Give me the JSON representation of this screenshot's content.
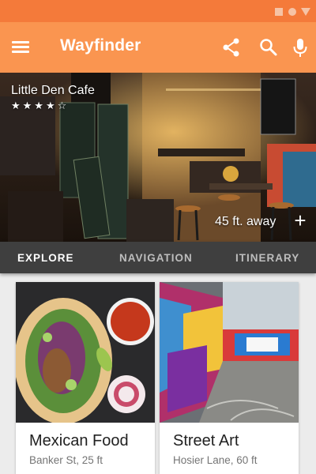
{
  "app": {
    "title": "Wayfinder"
  },
  "colors": {
    "status_bar": "#f47a3a",
    "app_bar": "#fa9550",
    "tab_bar": "#3f3f3f"
  },
  "toolbar": {
    "icons": [
      "menu-icon",
      "share-icon",
      "search-icon",
      "mic-icon"
    ]
  },
  "featured": {
    "name": "Little Den Cafe",
    "stars": "★★★★☆",
    "rating": 4,
    "distance": "45 ft. away",
    "add_icon": "+"
  },
  "tabs": [
    {
      "label": "EXPLORE",
      "active": true
    },
    {
      "label": "NAVIGATION",
      "active": false
    },
    {
      "label": "ITINERARY",
      "active": false
    }
  ],
  "cards": [
    {
      "title": "Mexican Food",
      "subtitle": "Banker St, 25 ft"
    },
    {
      "title": "Street Art",
      "subtitle": "Hosier Lane, 60 ft"
    }
  ]
}
